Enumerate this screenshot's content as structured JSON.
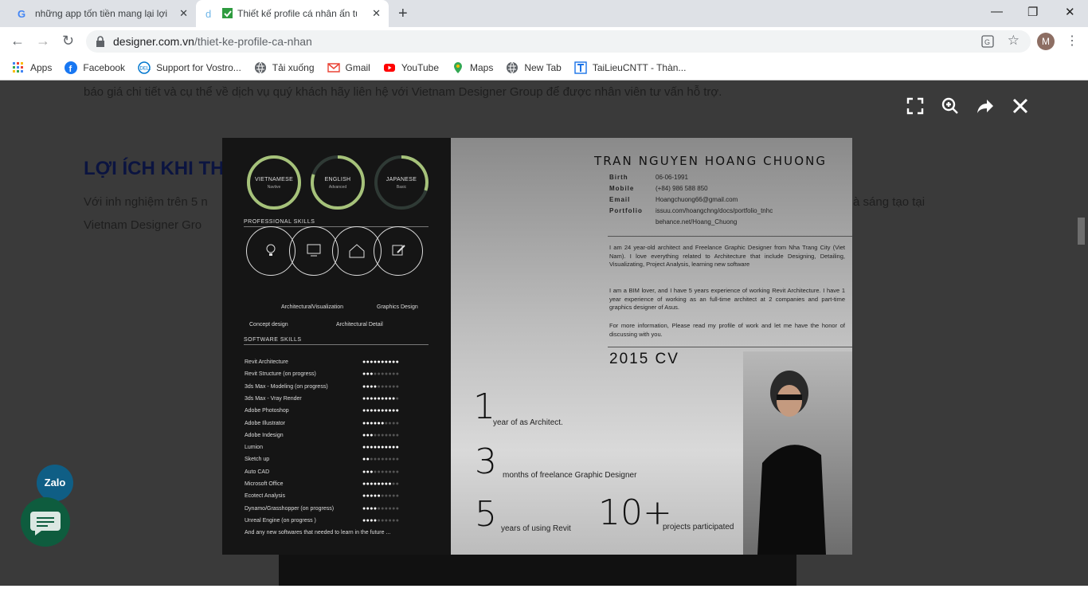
{
  "browser": {
    "tabs": [
      {
        "title": "những app tốn tiền mang lại lợi í"
      },
      {
        "title": "Thiết kế profile cá nhân ấn tư"
      }
    ],
    "url_host": "designer.com.vn",
    "url_path": "/thiet-ke-profile-ca-nhan",
    "avatar_letter": "M",
    "bookmarks": [
      {
        "label": "Apps",
        "icon": "apps-grid-icon"
      },
      {
        "label": "Facebook",
        "icon": "facebook-icon"
      },
      {
        "label": "Support for Vostro...",
        "icon": "dell-icon"
      },
      {
        "label": "Tải xuống",
        "icon": "globe-icon"
      },
      {
        "label": "Gmail",
        "icon": "gmail-icon"
      },
      {
        "label": "YouTube",
        "icon": "youtube-icon"
      },
      {
        "label": "Maps",
        "icon": "maps-icon"
      },
      {
        "label": "New Tab",
        "icon": "globe-icon"
      },
      {
        "label": "TaiLieuCNTT - Thàn...",
        "icon": "tailieu-icon"
      }
    ]
  },
  "page": {
    "line1": "báo giá chi tiết và cụ thể về dịch vụ quý khách hãy liên hệ với Vietnam Designer Group để được nhân viên tư vấn hỗ trợ.",
    "heading": "LỢI ÍCH KHI TH",
    "para_left1": "Với inh nghiệm trên 5 n",
    "para_right1": "à sáng tạo tại",
    "para_left2": "Vietnam Designer Gro",
    "zalo": "Zalo"
  },
  "cv": {
    "languages": [
      {
        "name": "VIETNAMESE",
        "level": "Navtive",
        "fill": 1.0
      },
      {
        "name": "ENGLISH",
        "level": "Advanced",
        "fill": 0.8
      },
      {
        "name": "JAPANESE",
        "level": "Basic",
        "fill": 0.3
      }
    ],
    "professional_title": "PROFESSIONAL SKILLS",
    "skill_labels": [
      "Concept design",
      "ArchitecturalVisualization",
      "Architectural Detail",
      "Graphics Design"
    ],
    "software_title": "SOFTWARE SKILLS",
    "software": [
      {
        "name": "Revit Architecture",
        "level": 10
      },
      {
        "name": "Revit Structure (on progress)",
        "level": 3
      },
      {
        "name": "3ds Max - Modeling (on progress)",
        "level": 4
      },
      {
        "name": "3ds Max - Vray Render",
        "level": 9
      },
      {
        "name": "Adobe Photoshop",
        "level": 10
      },
      {
        "name": "Adobe Illustrator",
        "level": 6
      },
      {
        "name": "Adobe Indesign",
        "level": 3
      },
      {
        "name": "Lumion",
        "level": 10
      },
      {
        "name": "Sketch up",
        "level": 2
      },
      {
        "name": "Auto CAD",
        "level": 3
      },
      {
        "name": "Microsoft Office",
        "level": 8
      },
      {
        "name": "Ecotect Analysis",
        "level": 5
      },
      {
        "name": "Dynamo/Grasshopper (on progress)",
        "level": 4
      },
      {
        "name": "Unreal Engine (on progress )",
        "level": 4
      }
    ],
    "software_note": "And any new softwares that needed to learn in the future ...",
    "name": "TRAN NGUYEN HOANG CHUONG",
    "birth_label": "Birth",
    "birth": "06-06-1991",
    "mobile_label": "Mobile",
    "mobile": "(+84) 986 588 850",
    "email_label": "Email",
    "email": "Hoangchuong66@gmail.com",
    "portfolio_label": "Portfolio",
    "portfolio1": "issuu.com/hoangchng/docs/portfolio_tnhc",
    "portfolio2": "behance.net/Hoang_Chuong",
    "about1": "I am 24 year-old architect and Freelance Graphic Designer from Nha Trang City (Viet Nam). I love everything related to Architecture that include Designing, Detailing, Visualizating, Project Analysis, learning new software",
    "about2": "I am a BIM lover, and I have 5 years experience of working Revit Architecture. I have 1 year experience of working as an full-time architect at 2 companies and part-time graphics designer of Asus.",
    "about3": "For more information, Please read my profile of work and let me have the honor of discussing with you.",
    "cv_year": "2015 CV",
    "stats": [
      {
        "num": "1",
        "text": "year of as Architect."
      },
      {
        "num": "3",
        "text": "months of freelance Graphic Designer"
      },
      {
        "num": "5",
        "text": "years of using Revit"
      },
      {
        "num": "10+",
        "text": "projects participated"
      }
    ]
  }
}
